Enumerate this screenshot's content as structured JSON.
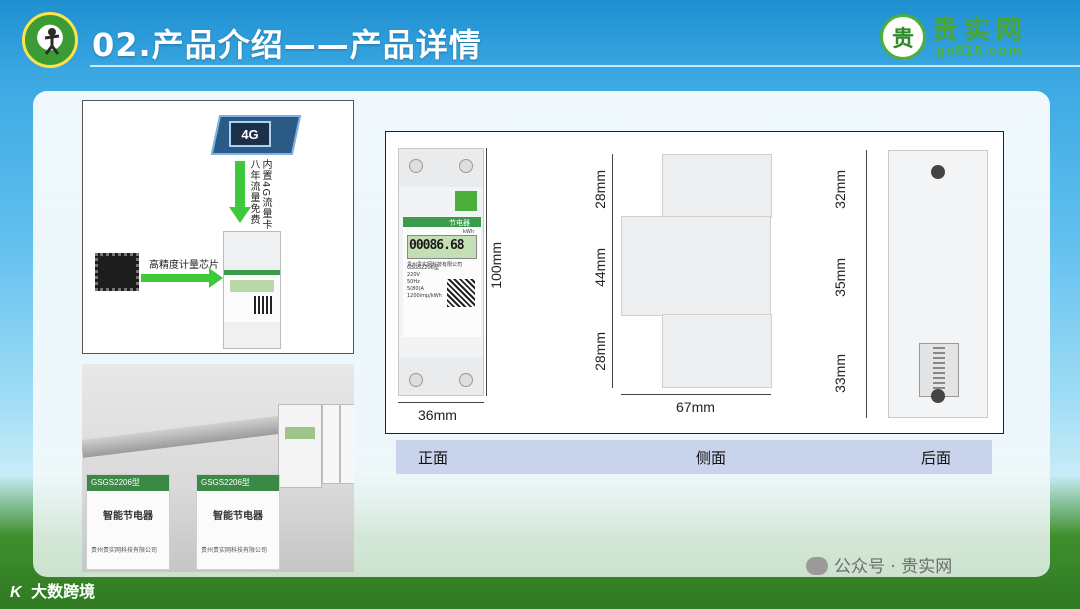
{
  "header": {
    "title": "02.产品介绍——产品详情",
    "brand_name": "贵实网",
    "brand_url": "gs816.com",
    "brand_mark": "贵"
  },
  "diagram": {
    "chip_4g_label": "4G",
    "sim_text": "内置4G流量卡",
    "free_text": "八年流量免费",
    "chip_label": "高精度计量芯片"
  },
  "boxes": [
    {
      "model": "GSGS2206型",
      "name": "智能节电器",
      "company": "贵州贵实网科技有限公司"
    },
    {
      "model": "GSGS2206型",
      "name": "智能节电器",
      "company": "贵州贵实网科技有限公司"
    }
  ],
  "figure": {
    "front": {
      "width": "36mm",
      "height": "100mm",
      "display": "00086.68",
      "unit": "kWh",
      "brand": "节电器",
      "company": "贵州贵实网科技有限公司",
      "model": "GSGS2206型",
      "specs": [
        "220V",
        "50Hz",
        "5(80)A",
        "1200imp/kWh"
      ]
    },
    "side": {
      "width": "67mm",
      "top": "28mm",
      "middle": "44mm",
      "bottom": "28mm"
    },
    "back": {
      "top": "32mm",
      "middle": "35mm",
      "bottom": "33mm"
    }
  },
  "labels": {
    "front": "正面",
    "side": "侧面",
    "back": "后面"
  },
  "footer": {
    "logo_mark": "K",
    "logo_text": "大数跨境",
    "wechat": "公众号 · 贵实网"
  },
  "colors": {
    "accent_green": "#3a9b4b",
    "sky_blue": "#3aa7e2",
    "label_bar": "#c9d4ec"
  }
}
